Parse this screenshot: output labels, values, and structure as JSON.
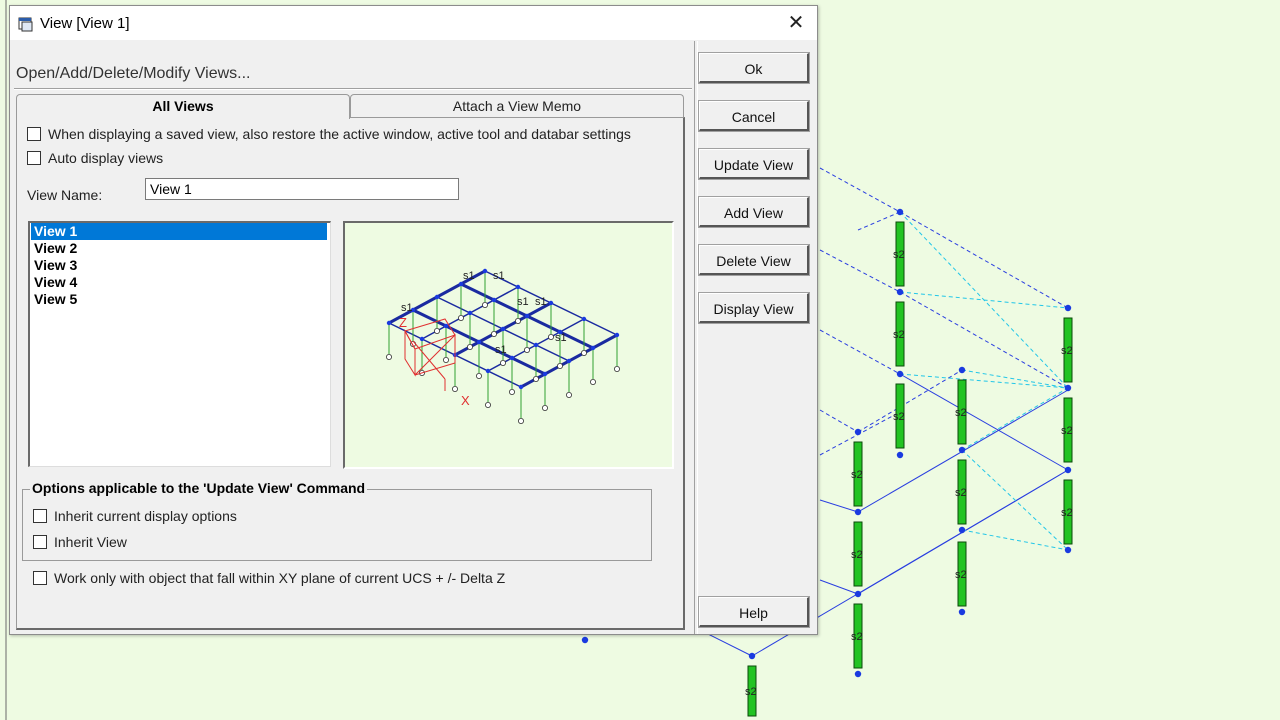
{
  "window": {
    "title": "View [View 1]"
  },
  "dialog": {
    "heading": "Open/Add/Delete/Modify Views...",
    "tabs": [
      {
        "label": "All Views"
      },
      {
        "label": "Attach a View Memo"
      }
    ],
    "options": {
      "restore_settings": "When displaying a saved view, also restore the active window, active tool and databar settings",
      "auto_display": "Auto display views"
    },
    "view_name": {
      "label": "View Name:",
      "value": "View 1"
    },
    "views": [
      "View 1",
      "View 2",
      "View 3",
      "View 4",
      "View 5"
    ],
    "selected_view": "View 1",
    "update_group": {
      "label": "Options applicable to the 'Update View' Command",
      "inherit_display": "Inherit current display options",
      "inherit_view": "Inherit View"
    },
    "xy_plane_option": "Work only with object that fall within XY plane of current UCS + /- Delta Z",
    "preview": {
      "labels": {
        "member": "s1",
        "axis_x": "X",
        "axis_z": "Z"
      }
    }
  },
  "buttons": {
    "ok": "Ok",
    "cancel": "Cancel",
    "update_view": "Update View",
    "add_view": "Add View",
    "delete_view": "Delete View",
    "display_view": "Display View",
    "help": "Help"
  },
  "canvas": {
    "member_label": "s2"
  }
}
